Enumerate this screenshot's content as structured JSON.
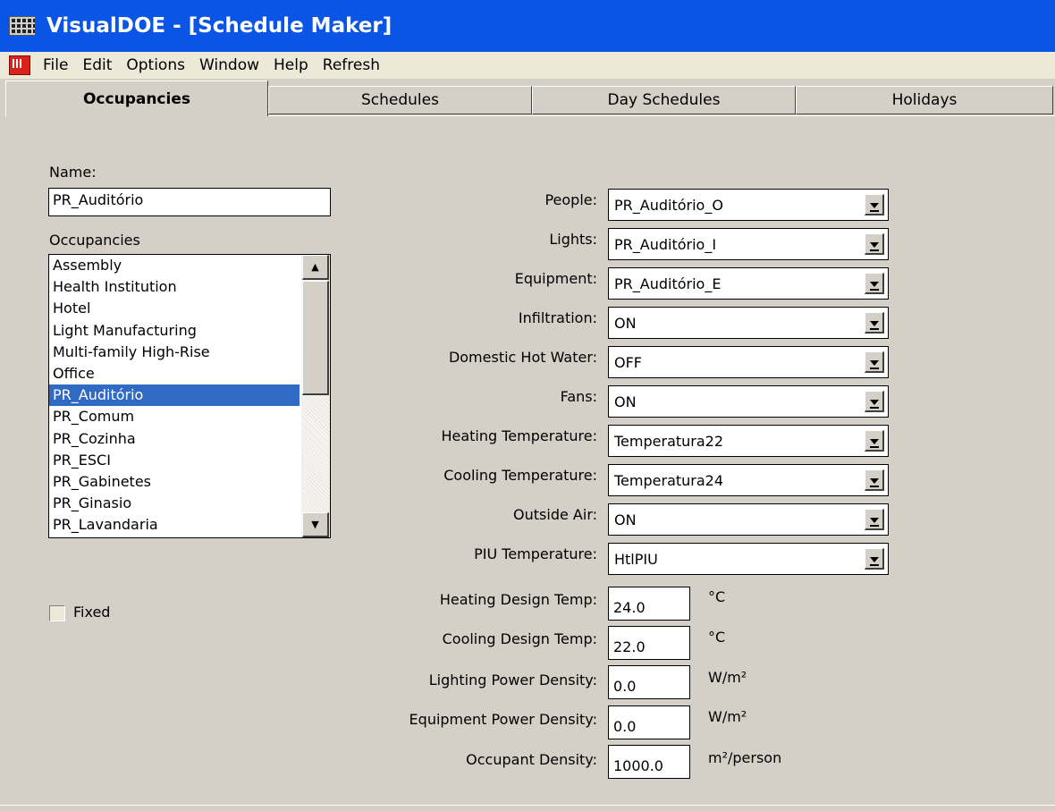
{
  "window": {
    "title": "VisualDOE - [Schedule Maker]",
    "icon": "building-grid-icon"
  },
  "menu": {
    "icon": "app-menu-icon",
    "items": [
      {
        "label": "File"
      },
      {
        "label": "Edit"
      },
      {
        "label": "Options"
      },
      {
        "label": "Window"
      },
      {
        "label": "Help"
      },
      {
        "label": "Refresh"
      }
    ]
  },
  "tabs": [
    {
      "label": "Occupancies",
      "active": true
    },
    {
      "label": "Schedules",
      "active": false
    },
    {
      "label": "Day Schedules",
      "active": false
    },
    {
      "label": "Holidays",
      "active": false
    }
  ],
  "left": {
    "name_label": "Name:",
    "name_value": "PR_Auditório",
    "occupancies_label": "Occupancies",
    "occupancies": [
      "Assembly",
      "Health Institution",
      "Hotel",
      "Light Manufacturing",
      "Multi-family High-Rise",
      "Office",
      "PR_Auditório",
      "PR_Comum",
      "PR_Cozinha",
      "PR_ESCI",
      "PR_Gabinetes",
      "PR_Ginasio",
      "PR_Lavandaria"
    ],
    "selected_occupancy": "PR_Auditório",
    "fixed_label": "Fixed",
    "fixed_checked": false
  },
  "fields": {
    "people": {
      "label": "People:",
      "value": "PR_Auditório_O"
    },
    "lights": {
      "label": "Lights:",
      "value": "PR_Auditório_I"
    },
    "equipment": {
      "label": "Equipment:",
      "value": "PR_Auditório_E"
    },
    "infiltration": {
      "label": "Infiltration:",
      "value": "ON"
    },
    "dhw": {
      "label": "Domestic Hot Water:",
      "value": "OFF"
    },
    "fans": {
      "label": "Fans:",
      "value": "ON"
    },
    "heating_temp": {
      "label": "Heating Temperature:",
      "value": "Temperatura22"
    },
    "cooling_temp": {
      "label": "Cooling Temperature:",
      "value": "Temperatura24"
    },
    "outside_air": {
      "label": "Outside Air:",
      "value": "ON"
    },
    "piu_temp": {
      "label": "PIU Temperature:",
      "value": "HtlPIU"
    }
  },
  "numeric": {
    "heating_design": {
      "label": "Heating Design Temp:",
      "value": "24.0",
      "unit": "°C"
    },
    "cooling_design": {
      "label": "Cooling Design Temp:",
      "value": "22.0",
      "unit": "°C"
    },
    "lighting_density": {
      "label": "Lighting Power Density:",
      "value": "0.0",
      "unit": "W/m²"
    },
    "equipment_density": {
      "label": "Equipment Power Density:",
      "value": "0.0",
      "unit": "W/m²"
    },
    "occupant_density": {
      "label": "Occupant Density:",
      "value": "1000.0",
      "unit": "m²/person"
    }
  }
}
